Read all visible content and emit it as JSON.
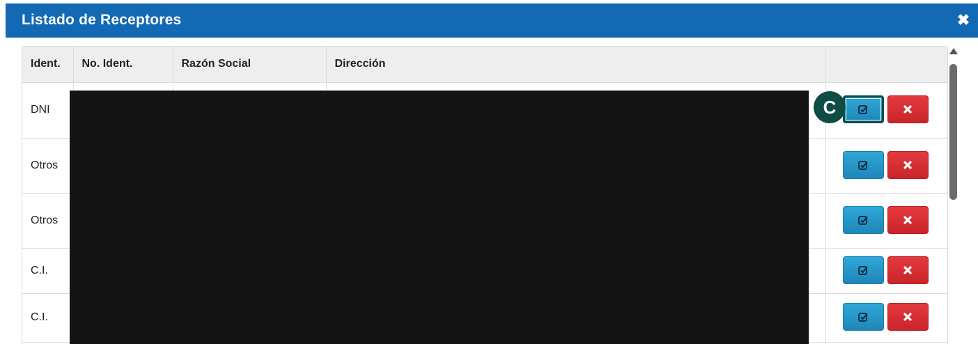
{
  "modal": {
    "title": "Listado de Receptores",
    "close_icon": "close-icon"
  },
  "table": {
    "columns": [
      "Ident.",
      "No. Ident.",
      "Razón Social",
      "Dirección",
      ""
    ],
    "rows": [
      {
        "ident": "DNI"
      },
      {
        "ident": "Otros"
      },
      {
        "ident": "Otros"
      },
      {
        "ident": "C.I."
      },
      {
        "ident": "C.I."
      }
    ],
    "action_icons": {
      "edit": "check-square-icon",
      "delete": "times-icon"
    }
  },
  "marker": {
    "label": "C"
  },
  "colors": {
    "header_bg": "#1369b3",
    "edit_button": "#2597c8",
    "delete_button": "#d72f34",
    "marker": "#0e4c45",
    "redaction": "#141414"
  }
}
